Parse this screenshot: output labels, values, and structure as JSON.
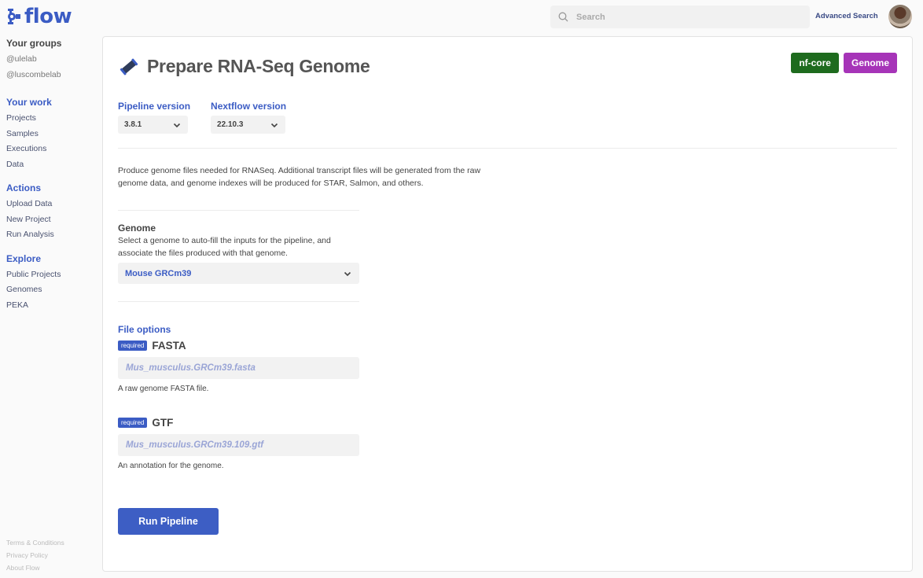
{
  "app": {
    "logo_text": "flow",
    "brand_color": "#3b5cc4"
  },
  "header": {
    "search_placeholder": "Search",
    "advanced_search": "Advanced Search"
  },
  "sidebar": {
    "groups_heading": "Your groups",
    "groups": [
      "@ulelab",
      "@luscombelab"
    ],
    "sections": [
      {
        "heading": "Your work",
        "items": [
          "Projects",
          "Samples",
          "Executions",
          "Data"
        ]
      },
      {
        "heading": "Actions",
        "items": [
          "Upload Data",
          "New Project",
          "Run Analysis"
        ]
      },
      {
        "heading": "Explore",
        "items": [
          "Public Projects",
          "Genomes",
          "PEKA"
        ]
      }
    ],
    "footer": [
      "Terms & Conditions",
      "Privacy Policy",
      "About Flow"
    ]
  },
  "main": {
    "title": "Prepare RNA-Seq Genome",
    "badges": [
      {
        "label": "nf-core",
        "color": "#1e6b1e"
      },
      {
        "label": "Genome",
        "color": "#a634b8"
      }
    ],
    "pipeline_version": {
      "label": "Pipeline version",
      "value": "3.8.1"
    },
    "nextflow_version": {
      "label": "Nextflow version",
      "value": "22.10.3"
    },
    "description": "Produce genome files needed for RNASeq. Additional transcript files will be generated from the raw genome data, and genome indexes will be produced for STAR, Salmon, and others.",
    "genome": {
      "title": "Genome",
      "help": "Select a genome to auto-fill the inputs for the pipeline, and associate the files produced with that genome.",
      "selected": "Mouse GRCm39"
    },
    "file_options": {
      "title": "File options",
      "fields": [
        {
          "badge": "required",
          "name": "FASTA",
          "value": "Mus_musculus.GRCm39.fasta",
          "help": "A raw genome FASTA file."
        },
        {
          "badge": "required",
          "name": "GTF",
          "value": "Mus_musculus.GRCm39.109.gtf",
          "help": "An annotation for the genome."
        }
      ]
    },
    "run_button": "Run Pipeline"
  }
}
